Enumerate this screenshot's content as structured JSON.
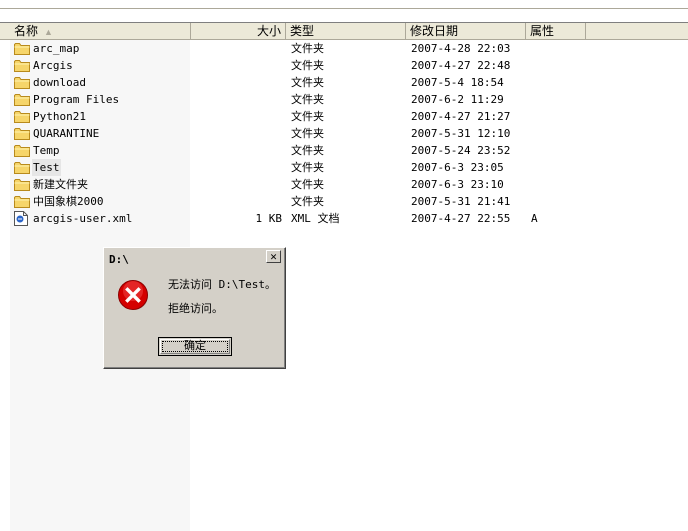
{
  "columns": {
    "name": "名称",
    "size": "大小",
    "type": "类型",
    "modified": "修改日期",
    "attributes": "属性"
  },
  "files": [
    {
      "name": "arc_map",
      "size": "",
      "type": "文件夹",
      "modified": "2007-4-28 22:03",
      "attr": "",
      "icon": "folder-icon"
    },
    {
      "name": "Arcgis",
      "size": "",
      "type": "文件夹",
      "modified": "2007-4-27 22:48",
      "attr": "",
      "icon": "folder-icon"
    },
    {
      "name": "download",
      "size": "",
      "type": "文件夹",
      "modified": "2007-5-4 18:54",
      "attr": "",
      "icon": "folder-icon"
    },
    {
      "name": "Program Files",
      "size": "",
      "type": "文件夹",
      "modified": "2007-6-2 11:29",
      "attr": "",
      "icon": "folder-icon"
    },
    {
      "name": "Python21",
      "size": "",
      "type": "文件夹",
      "modified": "2007-4-27 21:27",
      "attr": "",
      "icon": "folder-icon"
    },
    {
      "name": "QUARANTINE",
      "size": "",
      "type": "文件夹",
      "modified": "2007-5-31 12:10",
      "attr": "",
      "icon": "folder-icon"
    },
    {
      "name": "Temp",
      "size": "",
      "type": "文件夹",
      "modified": "2007-5-24 23:52",
      "attr": "",
      "icon": "folder-icon"
    },
    {
      "name": "Test",
      "size": "",
      "type": "文件夹",
      "modified": "2007-6-3 23:05",
      "attr": "",
      "icon": "folder-icon",
      "highlighted": true
    },
    {
      "name": "新建文件夹",
      "size": "",
      "type": "文件夹",
      "modified": "2007-6-3 23:10",
      "attr": "",
      "icon": "folder-icon"
    },
    {
      "name": "中国象棋2000",
      "size": "",
      "type": "文件夹",
      "modified": "2007-5-31 21:41",
      "attr": "",
      "icon": "folder-icon"
    },
    {
      "name": "arcgis-user.xml",
      "size": "1 KB",
      "type": "XML 文档",
      "modified": "2007-4-27 22:55",
      "attr": "A",
      "icon": "xml-file-icon"
    }
  ],
  "dialog": {
    "title": "D:\\",
    "message_line1": "无法访问 D:\\Test。",
    "message_line2": "拒绝访问。",
    "ok_label": "确定",
    "close_glyph": "✕",
    "icon": "error-icon"
  }
}
